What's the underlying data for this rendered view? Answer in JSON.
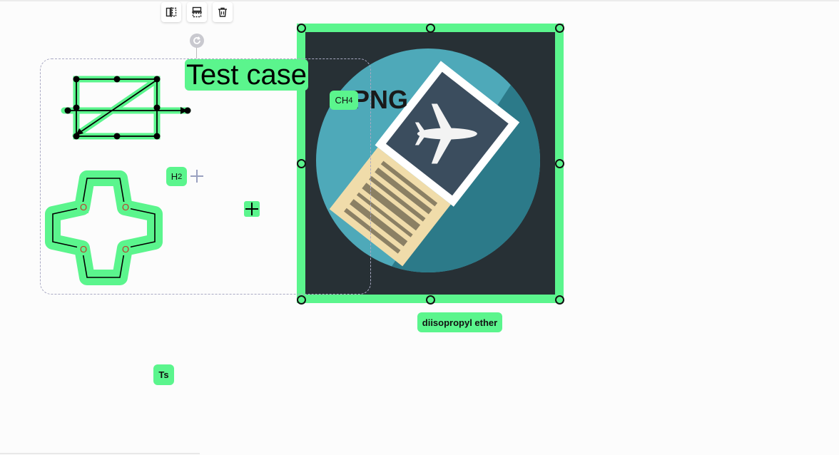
{
  "toolbar": {
    "flip_horizontal_icon": "flip-horizontal-icon",
    "flip_vertical_icon": "flip-vertical-icon",
    "delete_icon": "trash-icon",
    "rotate_icon": "rotate-icon"
  },
  "canvas": {
    "text_element": "Test case",
    "image_overlay_text": "PNG",
    "label_ch4": {
      "main": "CH",
      "sub": "4"
    },
    "label_h2": {
      "main": "H",
      "sub": "2"
    },
    "atom_label": "O",
    "pill_ether": "diisopropyl ether",
    "pill_ts": "Ts"
  },
  "colors": {
    "highlight": "#5bf58d",
    "selection_border": "#a9a9c3",
    "image_background": "#273035",
    "atom_red": "#c0392b"
  }
}
